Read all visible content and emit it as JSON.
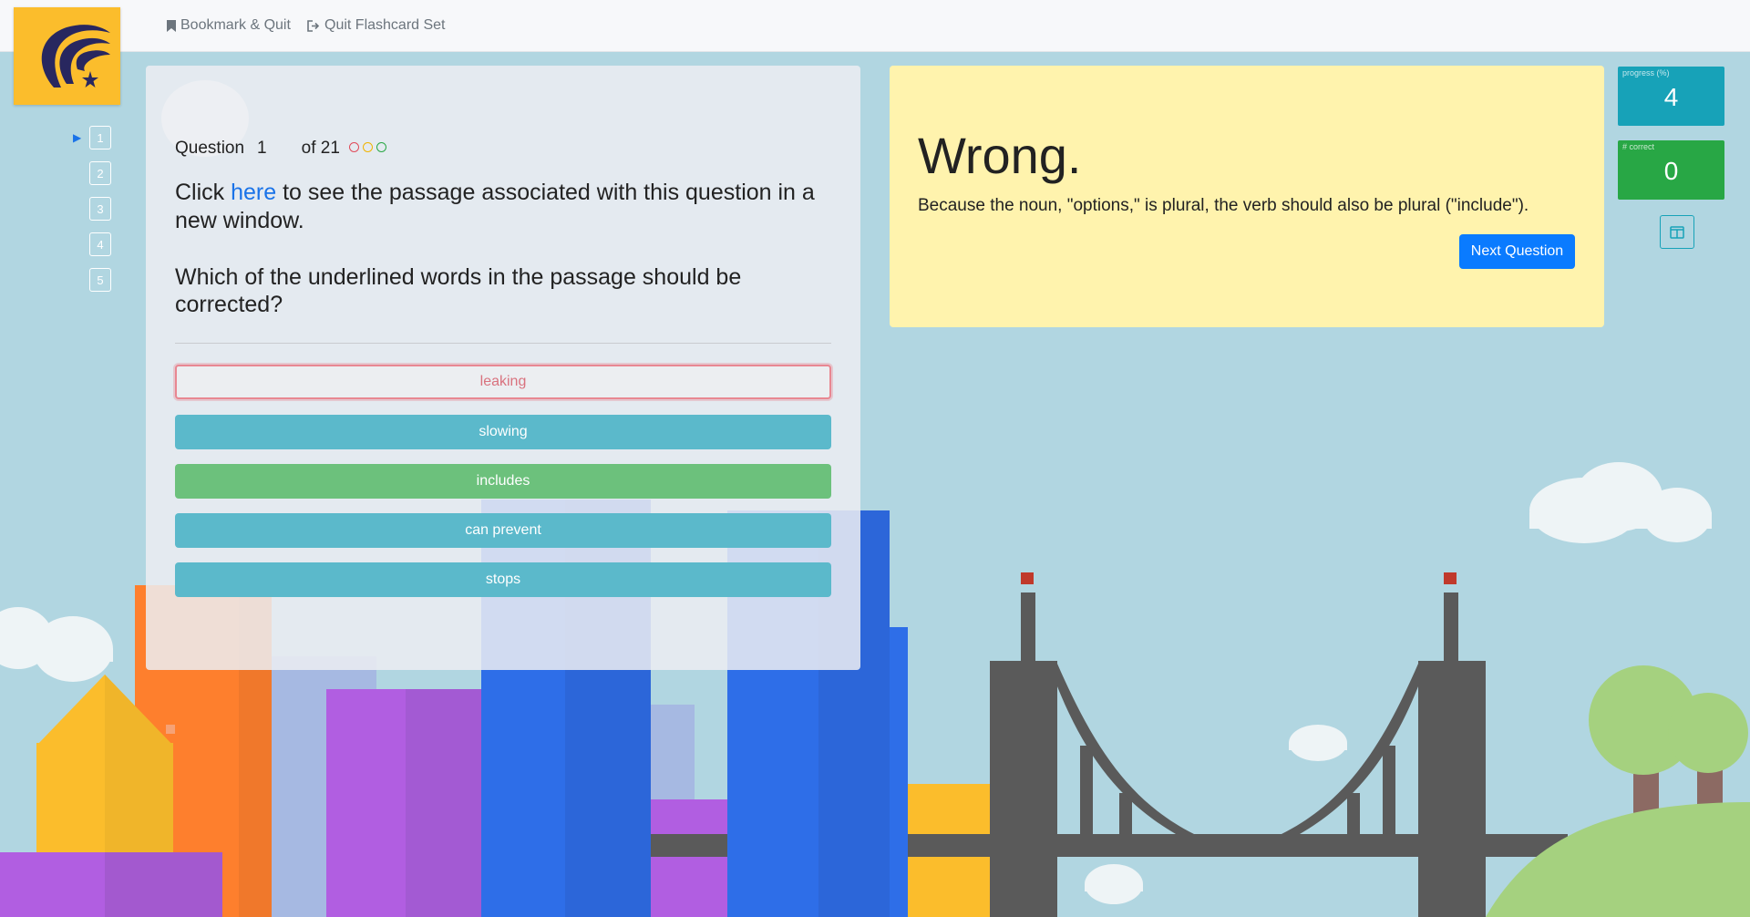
{
  "header": {
    "bookmark_quit": "Bookmark & Quit",
    "quit_set": "Quit Flashcard Set"
  },
  "question_nav": {
    "items": [
      "1",
      "2",
      "3",
      "4",
      "5"
    ],
    "current": "1"
  },
  "question": {
    "label": "Question",
    "number": "1",
    "of_total": "of 21",
    "passage_pre": "Click ",
    "passage_link": "here",
    "passage_post": " to see the passage associated with this question in a new window.",
    "prompt": "Which of the underlined words in the passage should be corrected?",
    "status_circle_colors": [
      "#e04b5a",
      "#f0b400",
      "#2aa845"
    ],
    "answers": [
      {
        "label": "leaking",
        "state": "wrong"
      },
      {
        "label": "slowing",
        "state": "info"
      },
      {
        "label": "includes",
        "state": "correct"
      },
      {
        "label": "can prevent",
        "state": "info"
      },
      {
        "label": "stops",
        "state": "info"
      }
    ]
  },
  "feedback": {
    "title": "Wrong.",
    "explanation": "Because the noun, \"options,\" is plural, the verb should also be plural (\"include\").",
    "next_button": "Next Question"
  },
  "stats": {
    "progress_label": "progress (%)",
    "progress_value": "4",
    "correct_label": "# correct",
    "correct_value": "0"
  },
  "colors": {
    "sky": "#b1d6e1",
    "logo_bg": "#fbbd2c",
    "logo_mark": "#28275f",
    "progress": "#17a2b8",
    "correct": "#28a745",
    "feedback_bg": "#fff3ad",
    "primary_button": "#0a7bff"
  },
  "icons": {
    "bookmark": "bookmark-icon",
    "quit": "sign-out-icon",
    "nav_current": "play-arrow-icon",
    "layout": "columns-icon"
  }
}
